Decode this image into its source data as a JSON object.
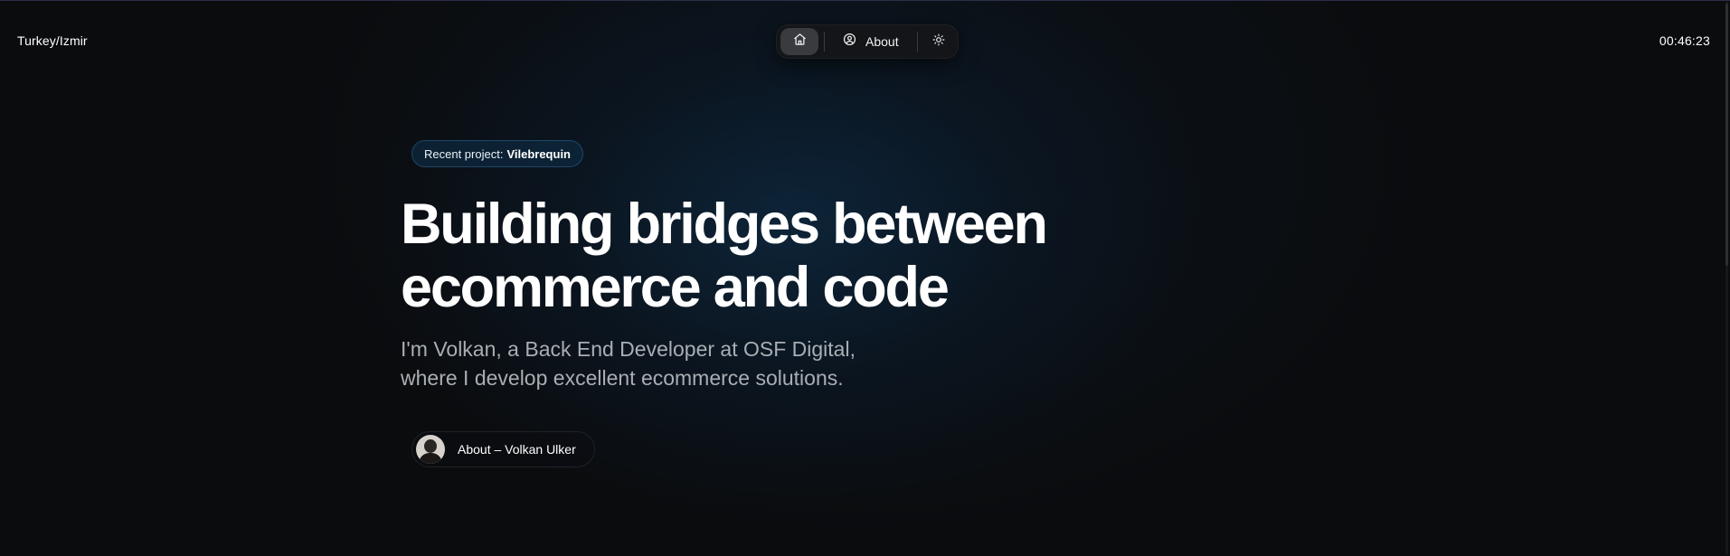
{
  "header": {
    "location": "Turkey/Izmir",
    "clock": "00:46:23"
  },
  "nav": {
    "home_icon": "home-icon",
    "about_label": "About",
    "about_icon": "user-circle-icon",
    "theme_icon": "sun-icon"
  },
  "hero": {
    "badge_prefix": "Recent project:",
    "badge_project": "Vilebrequin",
    "headline_line1": "Building bridges between",
    "headline_line2": "ecommerce and code",
    "subtext_line1": "I'm Volkan, a Back End Developer at OSF Digital,",
    "subtext_line2": "where I develop excellent ecommerce solutions.",
    "about_link_label": "About – Volkan Ulker"
  },
  "colors": {
    "background": "#0b0c0e",
    "glow": "#0f3250",
    "badge_bg": "#0e283e",
    "badge_border": "#1f4766",
    "subtext": "#a9aeb4"
  }
}
